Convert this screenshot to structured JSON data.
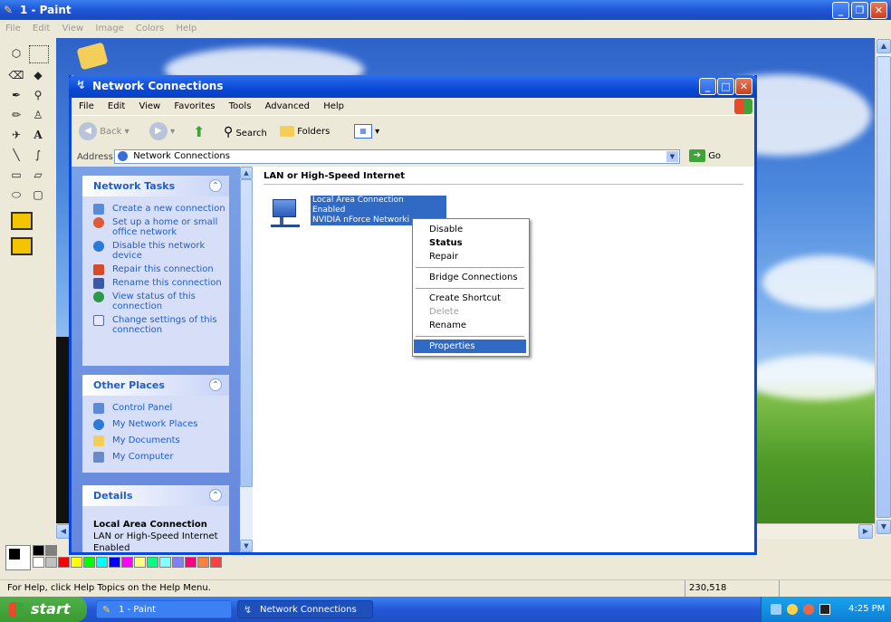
{
  "paint": {
    "title": "1 - Paint",
    "menu": [
      "File",
      "Edit",
      "View",
      "Image",
      "Colors",
      "Help"
    ],
    "status_text": "For Help, click Help Topics on the Help Menu.",
    "coords": "230,518"
  },
  "network": {
    "title": "Network Connections",
    "menu": [
      "File",
      "Edit",
      "View",
      "Favorites",
      "Tools",
      "Advanced",
      "Help"
    ],
    "toolbar": {
      "back": "Back",
      "search": "Search",
      "folders": "Folders"
    },
    "address_label": "Address",
    "address_value": "Network Connections",
    "go_label": "Go",
    "group_heading": "LAN or High-Speed Internet",
    "connection": {
      "name": "Local Area Connection",
      "status": "Enabled",
      "device": "NVIDIA nForce Networki"
    },
    "tasks_panel": {
      "title": "Network Tasks",
      "items": [
        {
          "label": "Create a new connection",
          "icon": "new-connection-icon"
        },
        {
          "label": "Set up a home or small office network",
          "icon": "home-network-icon"
        },
        {
          "label": "Disable this network device",
          "icon": "disable-device-icon"
        },
        {
          "label": "Repair this connection",
          "icon": "repair-icon"
        },
        {
          "label": "Rename this connection",
          "icon": "rename-icon"
        },
        {
          "label": "View status of this connection",
          "icon": "status-icon"
        },
        {
          "label": "Change settings of this connection",
          "icon": "settings-icon"
        }
      ]
    },
    "other_places": {
      "title": "Other Places",
      "items": [
        "Control Panel",
        "My Network Places",
        "My Documents",
        "My Computer"
      ]
    },
    "details": {
      "title": "Details",
      "name": "Local Area Connection",
      "type": "LAN or High-Speed Internet",
      "status": "Enabled"
    }
  },
  "context_menu": {
    "items": [
      "Disable",
      "Status",
      "Repair",
      "Bridge Connections",
      "Create Shortcut",
      "Delete",
      "Rename",
      "Properties"
    ]
  },
  "taskbar": {
    "start": "start",
    "buttons": [
      "1 - Paint",
      "Network Connections"
    ],
    "clock": "4:25 PM"
  },
  "colors": {
    "xp_blue": "#0a49d6",
    "task_link": "#215dc6",
    "selection": "#316ac5"
  }
}
